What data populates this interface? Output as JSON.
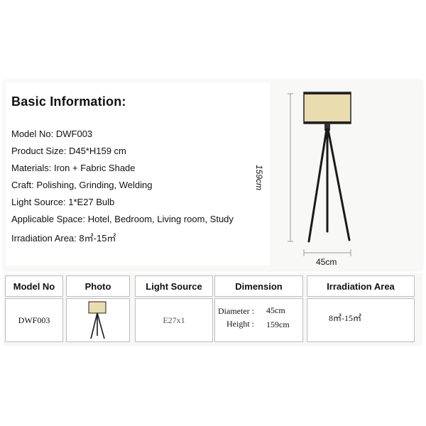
{
  "info": {
    "title": "Basic Information:",
    "specs": [
      {
        "label": "Model No:",
        "value": "DWF003"
      },
      {
        "label": "Product Size:",
        "value": "D45*H159 cm"
      },
      {
        "label": "Materials:",
        "value": "Iron + Fabric Shade"
      },
      {
        "label": "Craft:",
        "value": "Polishing, Grinding, Welding"
      },
      {
        "label": "Light Source:",
        "value": "1*E27 Bulb"
      },
      {
        "label": "Applicable Space:",
        "value": "Hotel, Bedroom, Living room, Study"
      },
      {
        "label": "Irradiation Area:",
        "value": "8㎡-15㎡"
      }
    ]
  },
  "diagram": {
    "height_label": "159cm",
    "width_label": "45cm"
  },
  "table": {
    "headers": [
      "Model No",
      "Photo",
      "Light Source",
      "Dimension",
      "Irradiation Area"
    ],
    "row": {
      "model": "DWF003",
      "light_source": "E27x1",
      "dimension": {
        "diameter_label": "Diameter :",
        "diameter_value": "45cm",
        "height_label": "Height :",
        "height_value": "159cm"
      },
      "irradiation": "8㎡-15㎡"
    }
  }
}
